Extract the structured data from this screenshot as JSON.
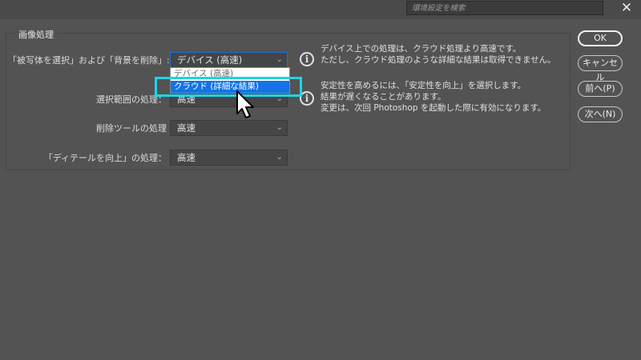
{
  "search": {
    "placeholder": "環境設定を検索"
  },
  "window": {
    "close_glyph": "✕"
  },
  "group": {
    "title": "画像処理"
  },
  "rows": [
    {
      "label": "「被写体を選択」および「背景を削除」:",
      "value": "デバイス (高速)"
    },
    {
      "label": "選択範囲の処理：",
      "value": "高速"
    },
    {
      "label": "削除ツールの処理",
      "value": "高速"
    },
    {
      "label": "「ディテールを向上」の処理：",
      "value": "高速"
    }
  ],
  "dropdown": {
    "options": [
      "デバイス (高速)",
      "クラウド (詳細な結果)"
    ],
    "selected_index": 1
  },
  "info": {
    "line1": "デバイス上での処理は、クラウド処理より高速です。",
    "line2": "ただし、クラウド処理のような詳細な結果は取得できません。",
    "line3": "安定性を高めるには、「安定性を向上」を選択します。",
    "line4": "結果が遅くなることがあります。",
    "line5": "変更は、次回 Photoshop を起動した際に有効になります。"
  },
  "buttons": {
    "ok": "OK",
    "cancel": "キャンセル",
    "prev": "前へ(P)",
    "next": "次へ(N)"
  },
  "icons": {
    "info": "info-icon",
    "chevron": "chevron-down-icon",
    "cursor": "pointer-cursor-icon"
  },
  "colors": {
    "accent": "#1473e6",
    "highlight": "#1ed4e6",
    "background": "#535353"
  }
}
